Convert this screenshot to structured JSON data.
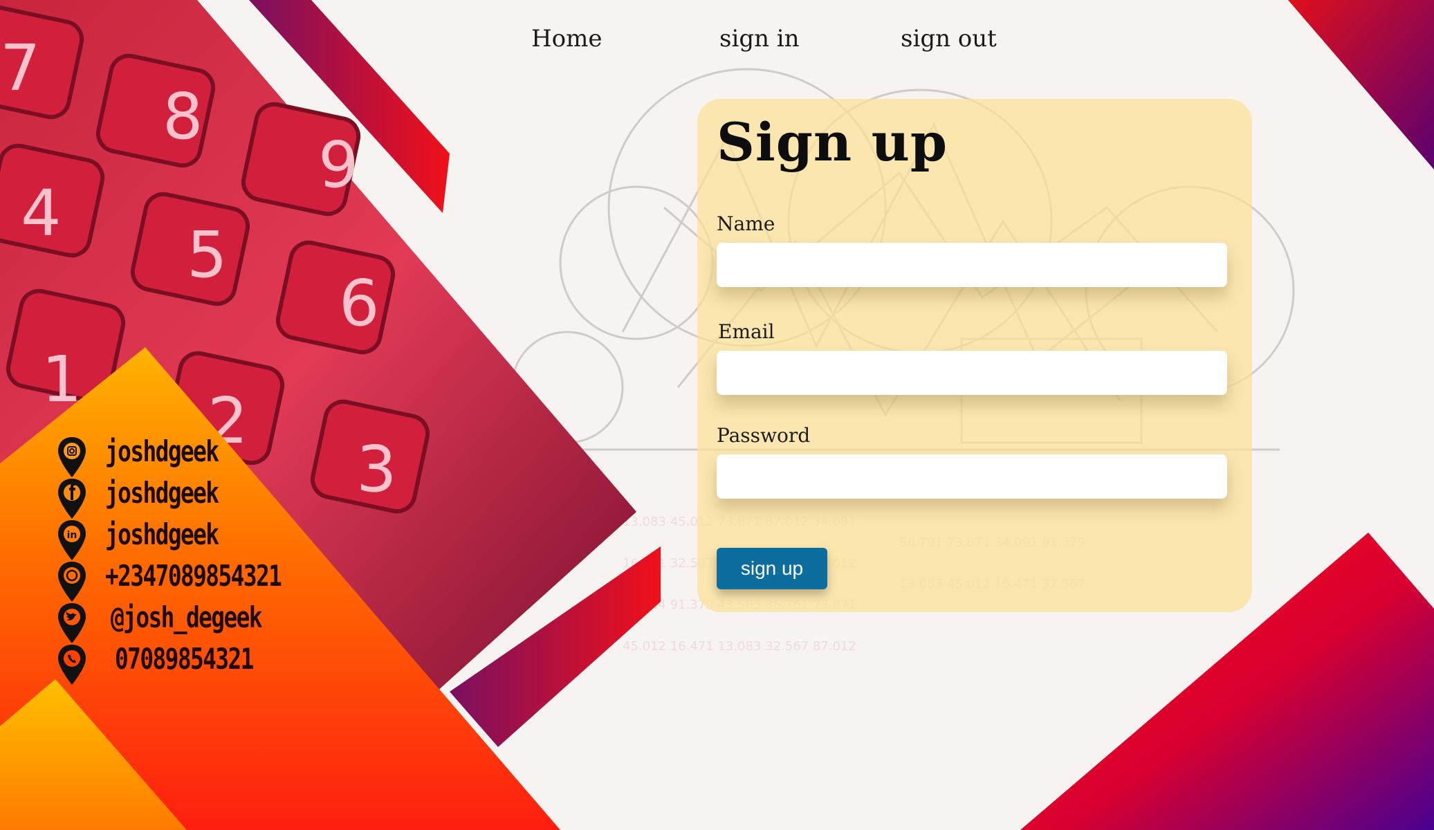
{
  "nav": {
    "home": "Home",
    "sign_in": "sign in",
    "sign_out": "sign out"
  },
  "form": {
    "title": "Sign up",
    "fields": [
      {
        "label": "Name",
        "value": "",
        "placeholder": ""
      },
      {
        "label": "Email",
        "value": "",
        "placeholder": ""
      },
      {
        "label": "Password",
        "value": "",
        "placeholder": ""
      }
    ],
    "submit_label": "sign up"
  },
  "social": [
    {
      "icon": "instagram-icon",
      "text": "joshdgeek"
    },
    {
      "icon": "facebook-icon",
      "text": "joshdgeek"
    },
    {
      "icon": "linkedin-icon",
      "text": "joshdgeek"
    },
    {
      "icon": "whatsapp-icon",
      "text": "+2347089854321"
    },
    {
      "icon": "twitter-icon",
      "text": "@josh_degeek"
    },
    {
      "icon": "viber-phone-icon",
      "text": "07089854321"
    }
  ],
  "colors": {
    "card": "#fce096",
    "button": "#0d6e9d",
    "accent_red": "#e8101e",
    "accent_orange": "#ff6a00",
    "accent_yellow": "#ffc200",
    "accent_purple": "#5b0080"
  }
}
